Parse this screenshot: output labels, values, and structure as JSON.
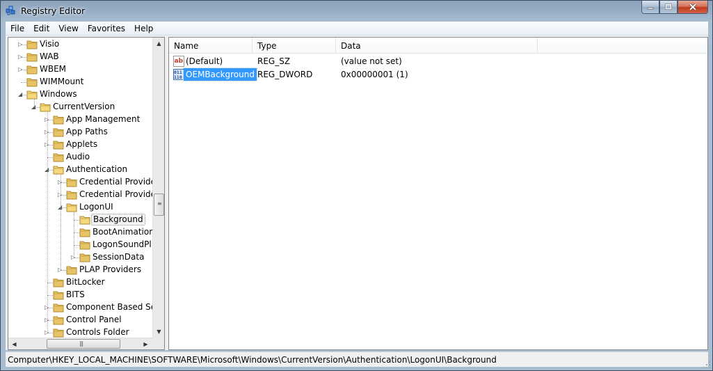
{
  "window": {
    "title": "Registry Editor",
    "controls": [
      "minimize",
      "maximize",
      "close"
    ]
  },
  "menu": [
    {
      "label": "File"
    },
    {
      "label": "Edit"
    },
    {
      "label": "View"
    },
    {
      "label": "Favorites"
    },
    {
      "label": "Help"
    }
  ],
  "tree": {
    "items": [
      {
        "label": "Visio",
        "level": 0,
        "toggle": "collapsed"
      },
      {
        "label": "WAB",
        "level": 0,
        "toggle": "collapsed"
      },
      {
        "label": "WBEM",
        "level": 0,
        "toggle": "collapsed"
      },
      {
        "label": "WIMMount",
        "level": 0,
        "toggle": "none"
      },
      {
        "label": "Windows",
        "level": 0,
        "toggle": "expanded"
      },
      {
        "label": "CurrentVersion",
        "level": 1,
        "toggle": "expanded"
      },
      {
        "label": "App Management",
        "level": 2,
        "toggle": "collapsed"
      },
      {
        "label": "App Paths",
        "level": 2,
        "toggle": "collapsed"
      },
      {
        "label": "Applets",
        "level": 2,
        "toggle": "collapsed"
      },
      {
        "label": "Audio",
        "level": 2,
        "toggle": "none"
      },
      {
        "label": "Authentication",
        "level": 2,
        "toggle": "expanded"
      },
      {
        "label": "Credential Provide",
        "level": 3,
        "toggle": "collapsed"
      },
      {
        "label": "Credential Provide",
        "level": 3,
        "toggle": "collapsed"
      },
      {
        "label": "LogonUI",
        "level": 3,
        "toggle": "expanded"
      },
      {
        "label": "Background",
        "level": 4,
        "toggle": "none",
        "selected": true
      },
      {
        "label": "BootAnimation",
        "level": 4,
        "toggle": "none"
      },
      {
        "label": "LogonSoundPl",
        "level": 4,
        "toggle": "none"
      },
      {
        "label": "SessionData",
        "level": 4,
        "toggle": "collapsed"
      },
      {
        "label": "PLAP Providers",
        "level": 3,
        "toggle": "collapsed"
      },
      {
        "label": "BitLocker",
        "level": 2,
        "toggle": "none"
      },
      {
        "label": "BITS",
        "level": 2,
        "toggle": "none"
      },
      {
        "label": "Component Based Ser",
        "level": 2,
        "toggle": "collapsed"
      },
      {
        "label": "Control Panel",
        "level": 2,
        "toggle": "collapsed"
      },
      {
        "label": "Controls Folder",
        "level": 2,
        "toggle": "collapsed"
      }
    ],
    "vscroll_position": 0.55,
    "hscroll_position": 0.3
  },
  "list": {
    "columns": [
      "Name",
      "Type",
      "Data"
    ],
    "rows": [
      {
        "icon": "string-value-icon",
        "name": "(Default)",
        "type": "REG_SZ",
        "data": "(value not set)",
        "selected": false
      },
      {
        "icon": "dword-value-icon",
        "name": "OEMBackground",
        "type": "REG_DWORD",
        "data": "0x00000001 (1)",
        "selected": true
      }
    ]
  },
  "status": {
    "path": "Computer\\HKEY_LOCAL_MACHINE\\SOFTWARE\\Microsoft\\Windows\\CurrentVersion\\Authentication\\LogonUI\\Background"
  },
  "colors": {
    "selection": "#3399ff",
    "folder": "#e8c468"
  }
}
